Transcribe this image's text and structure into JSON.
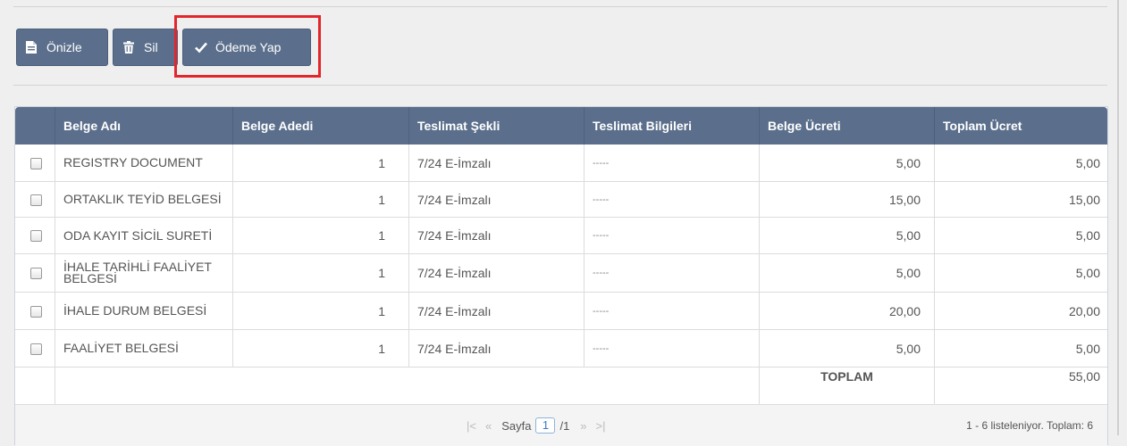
{
  "toolbar": {
    "preview_label": "Önizle",
    "delete_label": "Sil",
    "pay_label": "Ödeme Yap"
  },
  "table": {
    "columns": [
      "Belge Adı",
      "Belge Adedi",
      "Teslimat Şekli",
      "Teslimat Bilgileri",
      "Belge Ücreti",
      "Toplam Ücret"
    ],
    "rows": [
      {
        "name": "REGISTRY DOCUMENT",
        "count": "1",
        "delivery": "7/24 E-İmzalı",
        "info": "-----",
        "fee": "5,00",
        "total": "5,00"
      },
      {
        "name": "ORTAKLIK TEYİD BELGESİ",
        "count": "1",
        "delivery": "7/24 E-İmzalı",
        "info": "-----",
        "fee": "15,00",
        "total": "15,00"
      },
      {
        "name": "ODA KAYIT SİCİL SURETİ",
        "count": "1",
        "delivery": "7/24 E-İmzalı",
        "info": "-----",
        "fee": "5,00",
        "total": "5,00"
      },
      {
        "name": "İHALE TARİHLİ FAALİYET BELGESİ",
        "count": "1",
        "delivery": "7/24 E-İmzalı",
        "info": "-----",
        "fee": "5,00",
        "total": "5,00"
      },
      {
        "name": "İHALE DURUM BELGESİ",
        "count": "1",
        "delivery": "7/24 E-İmzalı",
        "info": "-----",
        "fee": "20,00",
        "total": "20,00"
      },
      {
        "name": "FAALİYET BELGESİ",
        "count": "1",
        "delivery": "7/24 E-İmzalı",
        "info": "-----",
        "fee": "5,00",
        "total": "5,00"
      }
    ],
    "total_label": "TOPLAM",
    "total_value": "55,00"
  },
  "pager": {
    "page_label": "Sayfa",
    "page_value": "1",
    "page_count": "/1",
    "first_icon": "first-page-icon",
    "prev_icon": "prev-page-icon",
    "next_icon": "next-page-icon",
    "last_icon": "last-page-icon",
    "summary": "1 - 6 listeleniyor. Toplam: 6"
  },
  "colors": {
    "toolbar_button": "#5b6f8c",
    "header": "#5b6f8c",
    "highlight": "#e3262c"
  }
}
